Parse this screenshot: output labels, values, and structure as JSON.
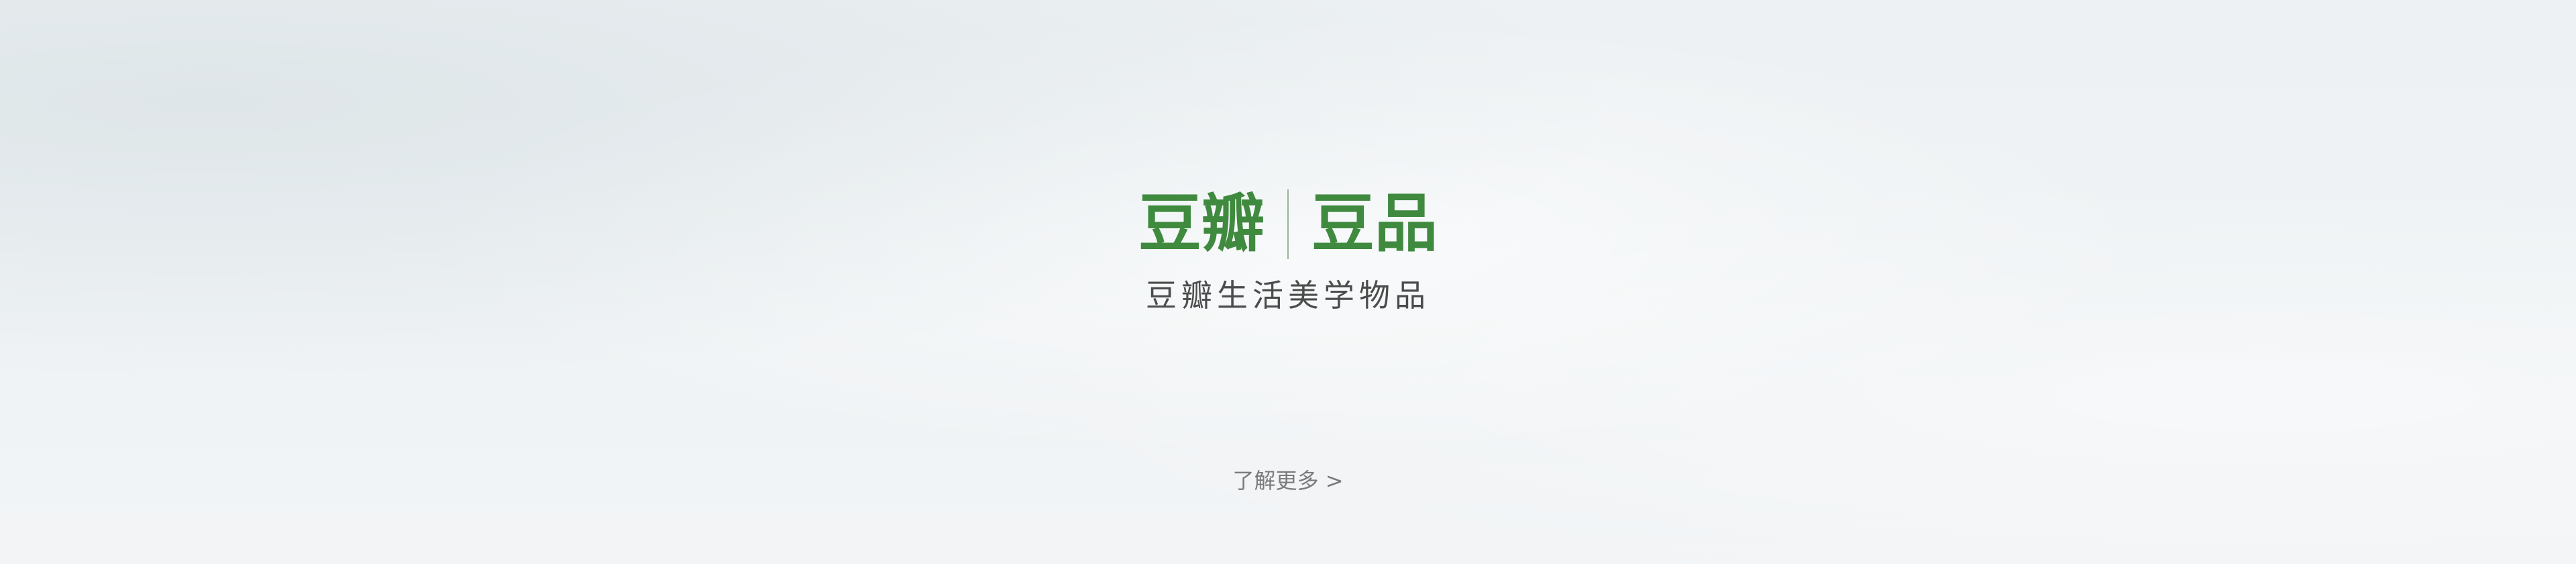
{
  "hero": {
    "logo": {
      "left_text": "豆瓣",
      "right_text": "豆品"
    },
    "tagline": "豆瓣生活美学物品",
    "learn_more": {
      "label": "了解更多",
      "arrow": ">"
    }
  },
  "colors": {
    "brand_green": "#3f8a3f",
    "tagline_text": "#4c4c4c",
    "link_text": "#7a7a7a"
  }
}
